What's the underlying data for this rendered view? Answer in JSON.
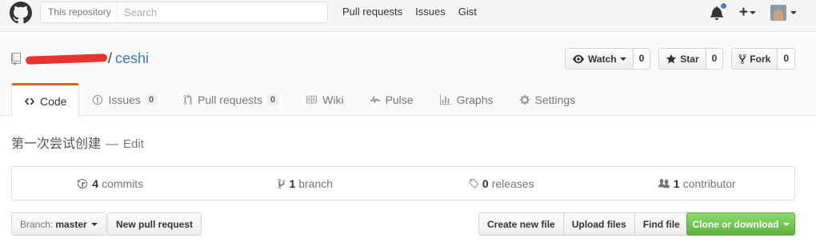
{
  "header": {
    "logo_icon": "github-octocat-icon",
    "search": {
      "scope": "This repository",
      "placeholder": "Search"
    },
    "nav": [
      {
        "label": "Pull requests"
      },
      {
        "label": "Issues"
      },
      {
        "label": "Gist"
      }
    ],
    "notification_icon": "bell-icon",
    "create_icon": "plus-icon",
    "notification_dot_color": "#4183c4"
  },
  "repo": {
    "owner": "",
    "owner_redacted": true,
    "separator": "/",
    "name": "ceshi",
    "actions": [
      {
        "label": "Watch",
        "count": "0",
        "icon": "eye-icon"
      },
      {
        "label": "Star",
        "count": "0",
        "icon": "star-icon"
      },
      {
        "label": "Fork",
        "count": "0",
        "icon": "repo-forked-icon"
      }
    ],
    "tabs": [
      {
        "label": "Code",
        "icon": "code-icon",
        "selected": true
      },
      {
        "label": "Issues",
        "icon": "issue-opened-icon",
        "count": "0"
      },
      {
        "label": "Pull requests",
        "icon": "git-pull-request-icon",
        "count": "0"
      },
      {
        "label": "Wiki",
        "icon": "book-icon"
      },
      {
        "label": "Pulse",
        "icon": "pulse-icon"
      },
      {
        "label": "Graphs",
        "icon": "graph-icon"
      },
      {
        "label": "Settings",
        "icon": "gear-icon"
      }
    ],
    "accent_color": "#d26911"
  },
  "description": {
    "text": "第一次尝试创建",
    "separator": "—",
    "edit_label": "Edit"
  },
  "summary": [
    {
      "count": "4",
      "label": "commits",
      "icon": "history-icon"
    },
    {
      "count": "1",
      "label": "branch",
      "icon": "git-branch-icon"
    },
    {
      "count": "0",
      "label": "releases",
      "icon": "tag-icon"
    },
    {
      "count": "1",
      "label": "contributor",
      "icon": "organization-icon"
    }
  ],
  "toolbar": {
    "branch_label": "Branch:",
    "branch_value": "master",
    "new_pr": "New pull request",
    "create_file": "Create new file",
    "upload_files": "Upload files",
    "find_file": "Find file",
    "clone": "Clone or download",
    "clone_color": "#6cc644"
  }
}
